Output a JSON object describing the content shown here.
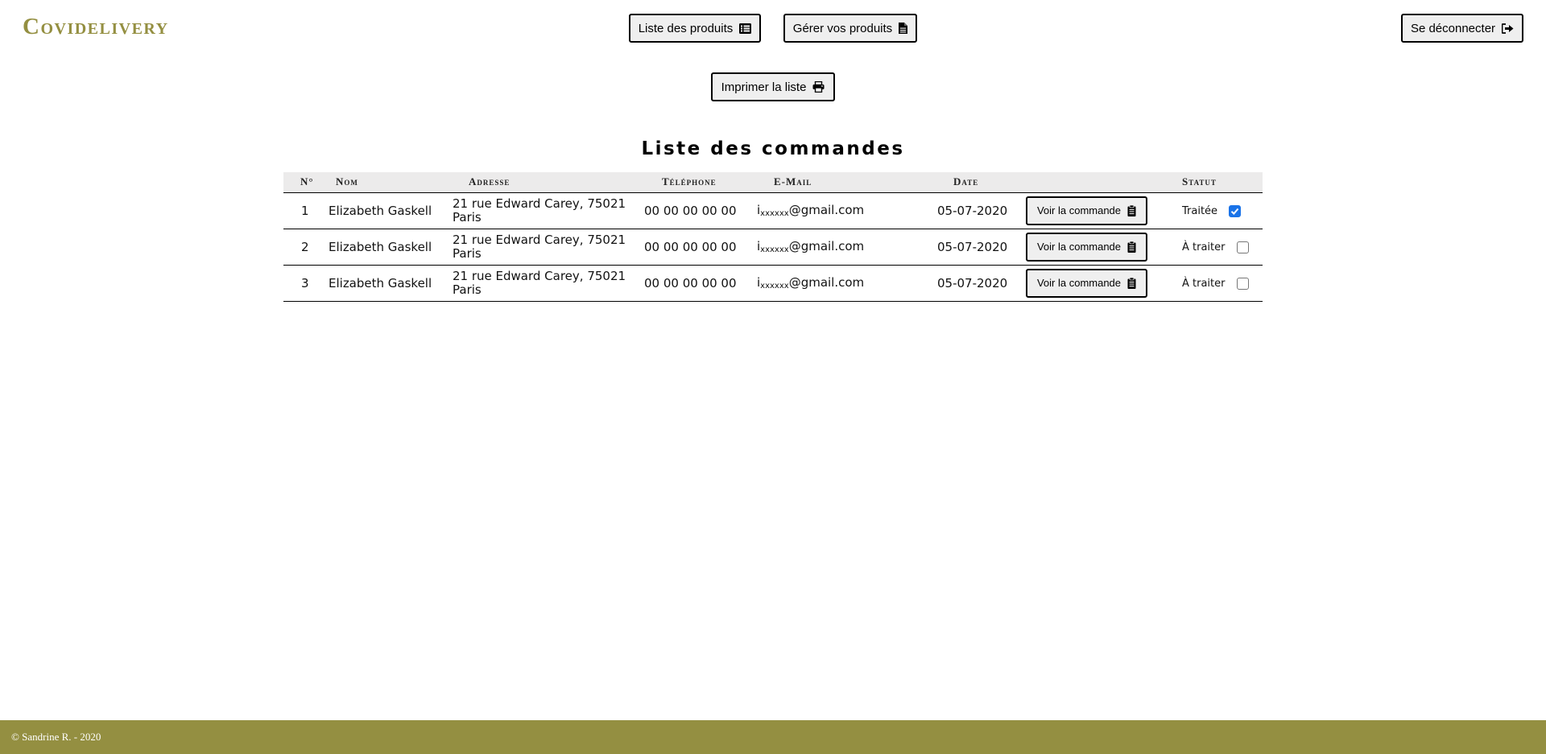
{
  "brand": {
    "name": "Covidelivery",
    "color": "#948f41"
  },
  "nav": {
    "list_products": {
      "label": "Liste des produits",
      "icon": "list-icon"
    },
    "manage_products": {
      "label": "Gérer vos produits",
      "icon": "file-icon"
    },
    "logout": {
      "label": "Se déconnecter",
      "icon": "sign-out-icon"
    },
    "print": {
      "label": "Imprimer la liste",
      "icon": "print-icon"
    }
  },
  "page": {
    "title": "Liste des commandes"
  },
  "table": {
    "headers": {
      "num": "N°",
      "name": "Nom",
      "address": "Adresse",
      "phone": "Téléphone",
      "email": "E-Mail",
      "date": "Date",
      "action": "",
      "status": "Statut"
    },
    "rows": [
      {
        "num": "1",
        "name": "Elizabeth Gaskell",
        "address": "21 rue Edward Carey, 75021 Paris",
        "phone": "00 00 00 00 00",
        "email_prefix": "i",
        "email_mask": "xxxxxx",
        "email_domain": "@gmail.com",
        "date": "05-07-2020",
        "action_label": "Voir la commande",
        "status": "Traitée",
        "checked": true
      },
      {
        "num": "2",
        "name": "Elizabeth Gaskell",
        "address": "21 rue Edward Carey, 75021 Paris",
        "phone": "00 00 00 00 00",
        "email_prefix": "i",
        "email_mask": "xxxxxx",
        "email_domain": "@gmail.com",
        "date": "05-07-2020",
        "action_label": "Voir la commande",
        "status": "À traiter",
        "checked": false
      },
      {
        "num": "3",
        "name": "Elizabeth Gaskell",
        "address": "21 rue Edward Carey, 75021 Paris",
        "phone": "00 00 00 00 00",
        "email_prefix": "i",
        "email_mask": "xxxxxx",
        "email_domain": "@gmail.com",
        "date": "05-07-2020",
        "action_label": "Voir la commande",
        "status": "À traiter",
        "checked": false
      }
    ]
  },
  "footer": {
    "text": "© Sandrine R. - 2020",
    "color": "#948f41"
  }
}
